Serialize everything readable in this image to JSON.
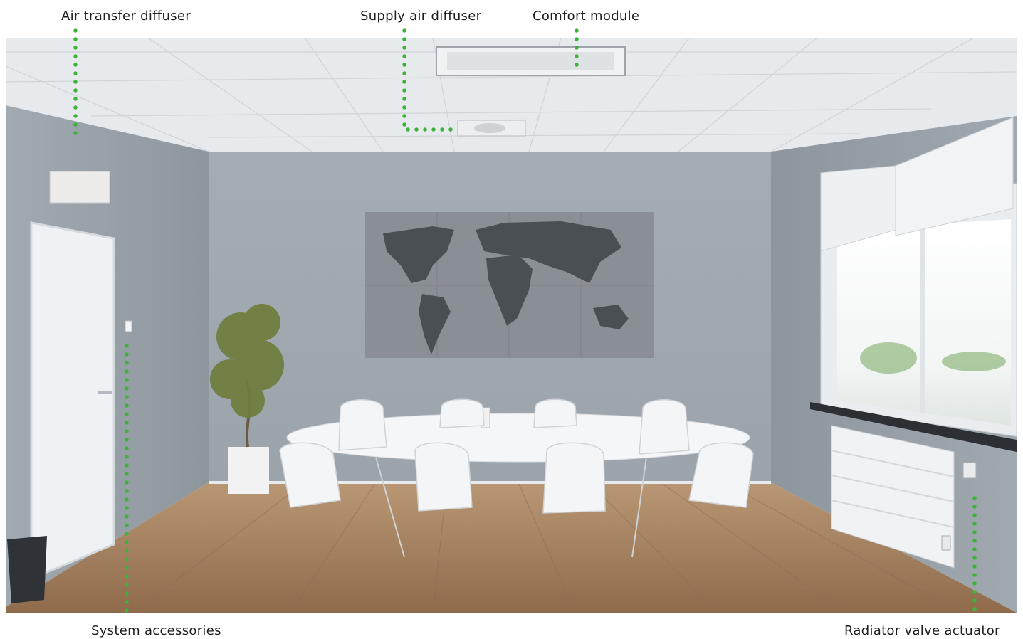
{
  "labels": {
    "air_transfer_diffuser": "Air transfer diffuser",
    "supply_air_diffuser": "Supply air diffuser",
    "comfort_module": "Comfort module",
    "system_accessories": "System accessories",
    "radiator_valve_actuator": "Radiator valve actuator"
  },
  "colors": {
    "callout_dot": "#3db33a",
    "label_text": "#1e1e1e",
    "wall": "#9aa3ac",
    "ceiling": "#e6e9eb",
    "floor": "#a98866",
    "map_panel": "#8b9096",
    "continents": "#4a4f54"
  }
}
